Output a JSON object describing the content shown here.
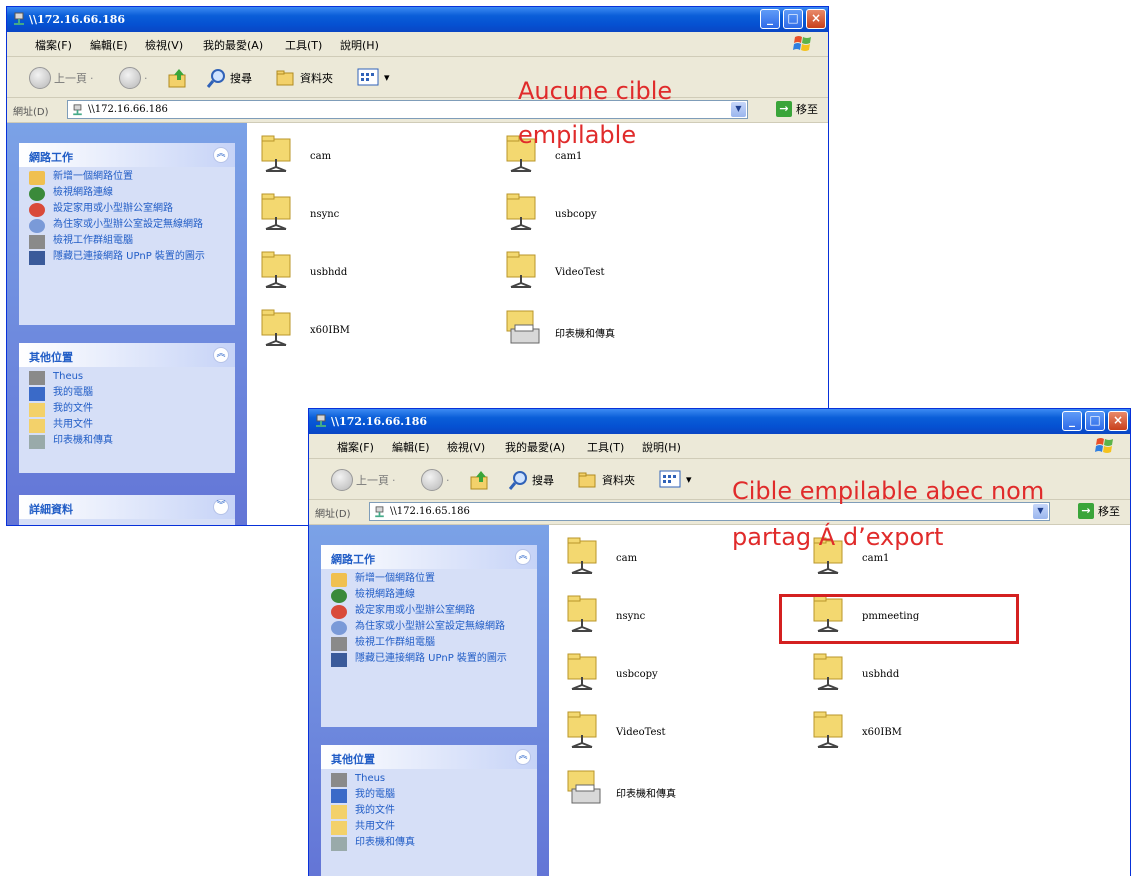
{
  "colors": {
    "title_bar": "#0a5ed8",
    "sidepane": "#6f8fe0",
    "link": "#215dc6",
    "caption": "#e02b2b",
    "highlight": "#d42020"
  },
  "window1": {
    "title": "\\\\172.16.66.186",
    "menu": [
      "檔案(F)",
      "編輯(E)",
      "檢視(V)",
      "我的最愛(A)",
      "工具(T)",
      "說明(H)"
    ],
    "toolbar": {
      "back": "上一頁",
      "search": "搜尋",
      "folders": "資料夾"
    },
    "address": {
      "label": "網址(D)",
      "value": "\\\\172.16.66.186",
      "go": "移至"
    },
    "network_tasks": {
      "title": "網路工作",
      "items": [
        "新增一個網路位置",
        "檢視網路連線",
        "設定家用或小型辦公室網路",
        "為住家或小型辦公室設定無線網路",
        "檢視工作群組電腦",
        "隱藏已連接網路 UPnP 裝置的圖示"
      ]
    },
    "other_places": {
      "title": "其他位置",
      "items": [
        "Theus",
        "我的電腦",
        "我的文件",
        "共用文件",
        "印表機和傳真"
      ]
    },
    "details": {
      "title": "詳細資料"
    },
    "files": [
      "cam",
      "cam1",
      "nsync",
      "usbcopy",
      "usbhdd",
      "VideoTest",
      "x60IBM",
      "印表機和傳真"
    ]
  },
  "window2": {
    "title": "\\\\172.16.66.186",
    "menu": [
      "檔案(F)",
      "編輯(E)",
      "檢視(V)",
      "我的最愛(A)",
      "工具(T)",
      "說明(H)"
    ],
    "toolbar": {
      "back": "上一頁",
      "search": "搜尋",
      "folders": "資料夾"
    },
    "address": {
      "label": "網址(D)",
      "value": "\\\\172.16.65.186",
      "go": "移至"
    },
    "network_tasks": {
      "title": "網路工作",
      "items": [
        "新增一個網路位置",
        "檢視網路連線",
        "設定家用或小型辦公室網路",
        "為住家或小型辦公室設定無線網路",
        "檢視工作群組電腦",
        "隱藏已連接網路 UPnP 裝置的圖示"
      ]
    },
    "other_places": {
      "title": "其他位置",
      "items": [
        "Theus",
        "我的電腦",
        "我的文件",
        "共用文件",
        "印表機和傳真"
      ]
    },
    "files": [
      "cam",
      "cam1",
      "nsync",
      "pmmeeting",
      "usbcopy",
      "usbhdd",
      "VideoTest",
      "x60IBM",
      "印表機和傳真"
    ]
  },
  "captions": {
    "no_target_line1": "Aucune cible",
    "no_target_line2": "empilable",
    "target_line1": "Cible empilable abec nom",
    "target_line2": "partag Á d’export"
  }
}
